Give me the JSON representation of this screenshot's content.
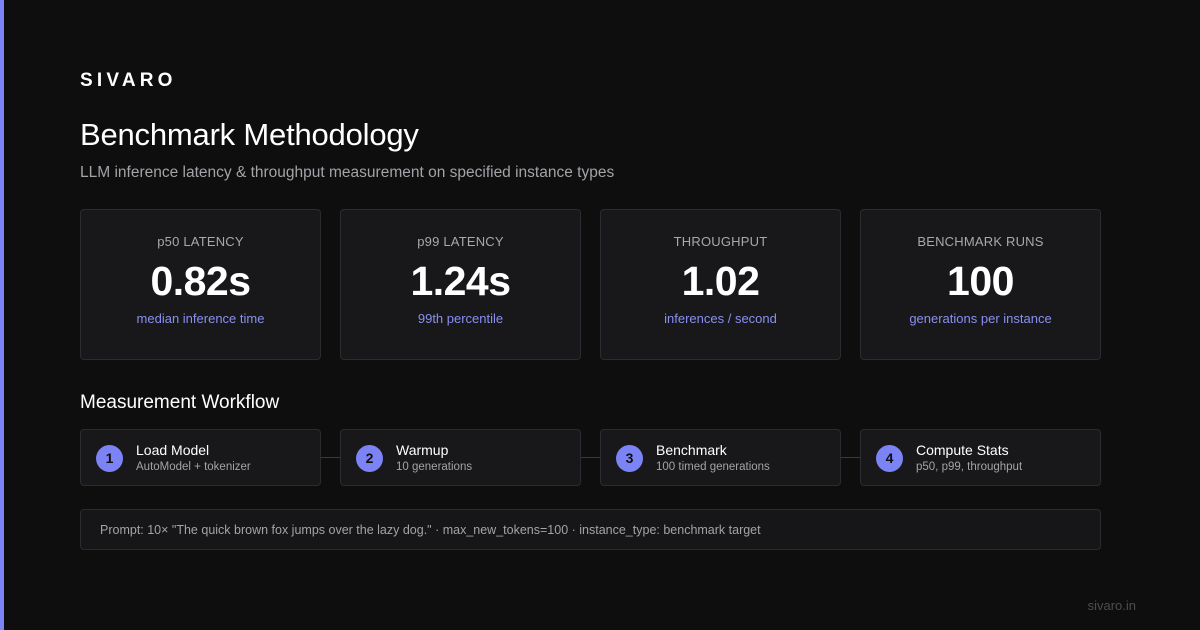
{
  "brand": "SIVARO",
  "title": "Benchmark Methodology",
  "subtitle": "LLM inference latency & throughput measurement on specified instance types",
  "metrics": [
    {
      "label": "p50 LATENCY",
      "value": "0.82s",
      "caption": "median inference time"
    },
    {
      "label": "p99 LATENCY",
      "value": "1.24s",
      "caption": "99th percentile"
    },
    {
      "label": "THROUGHPUT",
      "value": "1.02",
      "caption": "inferences / second"
    },
    {
      "label": "BENCHMARK RUNS",
      "value": "100",
      "caption": "generations per instance"
    }
  ],
  "workflow": {
    "heading": "Measurement Workflow",
    "steps": [
      {
        "number": "1",
        "title": "Load Model",
        "desc": "AutoModel + tokenizer"
      },
      {
        "number": "2",
        "title": "Warmup",
        "desc": "10 generations"
      },
      {
        "number": "3",
        "title": "Benchmark",
        "desc": "100 timed generations"
      },
      {
        "number": "4",
        "title": "Compute Stats",
        "desc": "p50, p99, throughput"
      }
    ]
  },
  "prompt_note": "Prompt: 10× \"The quick brown fox jumps over the lazy dog.\" · max_new_tokens=100 · instance_type: benchmark target",
  "footer": "sivaro.in",
  "colors": {
    "accent": "#7c83f5",
    "background": "#0e0e0f",
    "card": "#18181a",
    "caption": "#8a8ff0"
  }
}
